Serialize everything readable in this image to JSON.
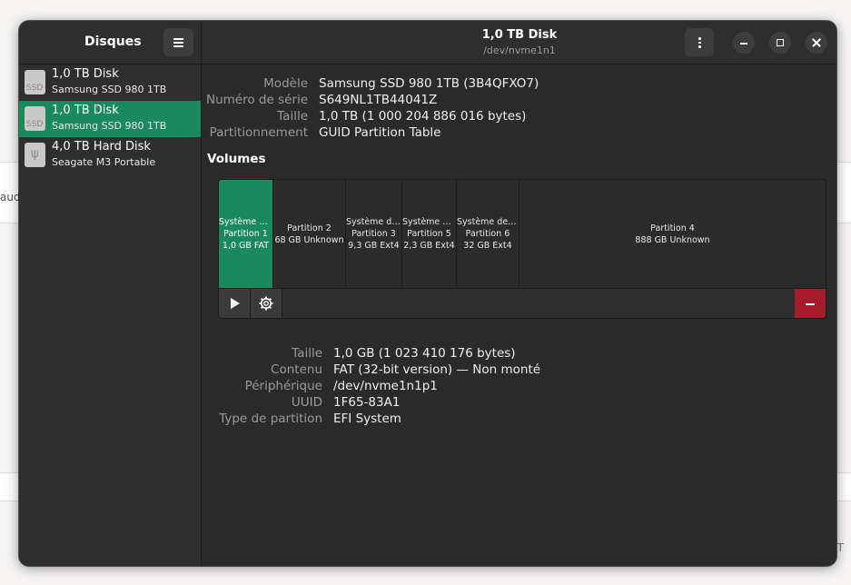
{
  "background": {
    "left_text": "aud",
    "right_text": "T"
  },
  "sidebar": {
    "title": "Disques",
    "disks": [
      {
        "name": "1,0 TB Disk",
        "model": "Samsung SSD 980 1TB",
        "icon": "ssd-icon",
        "icon_label": "SSD",
        "selected": false
      },
      {
        "name": "1,0 TB Disk",
        "model": "Samsung SSD 980 1TB",
        "icon": "ssd-icon",
        "icon_label": "SSD",
        "selected": true
      },
      {
        "name": "4,0 TB Hard Disk",
        "model": "Seagate M3 Portable",
        "icon": "usb-drive-icon",
        "icon_label": "",
        "selected": false
      }
    ]
  },
  "header": {
    "title": "1,0 TB Disk",
    "subtitle": "/dev/nvme1n1"
  },
  "disk_info": [
    {
      "label": "Modèle",
      "value": "Samsung SSD 980 1TB (3B4QFXO7)"
    },
    {
      "label": "Numéro de série",
      "value": "S649NL1TB44041Z"
    },
    {
      "label": "Taille",
      "value": "1,0 TB (1 000 204 886 016 bytes)"
    },
    {
      "label": "Partitionnement",
      "value": "GUID Partition Table"
    }
  ],
  "volumes": {
    "title": "Volumes",
    "partitions": [
      {
        "fs_name": "Système de ...",
        "name": "Partition 1",
        "info": "1,0 GB FAT",
        "selected": true
      },
      {
        "fs_name": "",
        "name": "Partition 2",
        "info": "68 GB Unknown",
        "selected": false
      },
      {
        "fs_name": "Système de ...",
        "name": "Partition 3",
        "info": "9,3 GB Ext4",
        "selected": false
      },
      {
        "fs_name": "Système de ...",
        "name": "Partition 5",
        "info": "2,3 GB Ext4",
        "selected": false
      },
      {
        "fs_name": "Système de fic...",
        "name": "Partition 6",
        "info": "32 GB Ext4",
        "selected": false
      },
      {
        "fs_name": "",
        "name": "Partition 4",
        "info": "888 GB Unknown",
        "selected": false
      }
    ]
  },
  "partition_info": [
    {
      "label": "Taille",
      "value": "1,0 GB (1 023 410 176 bytes)"
    },
    {
      "label": "Contenu",
      "value": "FAT (32-bit version) — Non monté"
    },
    {
      "label": "Périphérique",
      "value": "/dev/nvme1n1p1"
    },
    {
      "label": "UUID",
      "value": "1F65-83A1"
    },
    {
      "label": "Type de partition",
      "value": "EFI System"
    }
  ],
  "colors": {
    "accent": "#1a8a5c",
    "danger": "#a51d2d",
    "window_bg": "#2a2a2a"
  }
}
